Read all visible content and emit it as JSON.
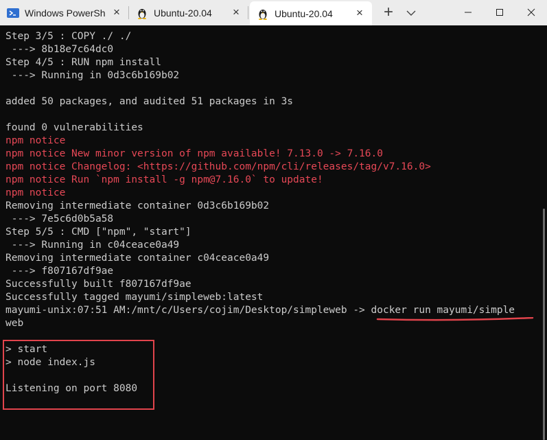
{
  "tabs": [
    {
      "label": "Windows PowerSh",
      "close": "×",
      "icon": "powershell-icon"
    },
    {
      "label": "Ubuntu-20.04",
      "close": "×",
      "icon": "linux-tux-icon"
    },
    {
      "label": "Ubuntu-20.04",
      "close": "×",
      "icon": "linux-tux-icon",
      "active": true
    }
  ],
  "toolbar": {
    "new_tab": "+",
    "dropdown_icon": "chevron-down-icon"
  },
  "window_controls": {
    "minimize_icon": "minimize-icon",
    "maximize_icon": "maximize-icon",
    "close_icon": "close-icon"
  },
  "colors": {
    "terminal_bg": "#0c0c0c",
    "text": "#cccccc",
    "error_red": "#e74856",
    "annotation_red": "#e2444c"
  },
  "terminal_lines": [
    {
      "text": "Step 3/5 : COPY ./ ./",
      "style": "normal"
    },
    {
      "text": " ---> 8b18e7c64dc0",
      "style": "normal"
    },
    {
      "text": "Step 4/5 : RUN npm install",
      "style": "normal"
    },
    {
      "text": " ---> Running in 0d3c6b169b02",
      "style": "normal"
    },
    {
      "text": "",
      "style": "normal"
    },
    {
      "text": "added 50 packages, and audited 51 packages in 3s",
      "style": "normal"
    },
    {
      "text": "",
      "style": "normal"
    },
    {
      "text": "found 0 vulnerabilities",
      "style": "normal"
    },
    {
      "text": "npm notice",
      "style": "error"
    },
    {
      "text": "npm notice New minor version of npm available! 7.13.0 -> 7.16.0",
      "style": "error"
    },
    {
      "text": "npm notice Changelog: <https://github.com/npm/cli/releases/tag/v7.16.0>",
      "style": "error"
    },
    {
      "text": "npm notice Run `npm install -g npm@7.16.0` to update!",
      "style": "error"
    },
    {
      "text": "npm notice",
      "style": "error"
    },
    {
      "text": "Removing intermediate container 0d3c6b169b02",
      "style": "normal"
    },
    {
      "text": " ---> 7e5c6d0b5a58",
      "style": "normal"
    },
    {
      "text": "Step 5/5 : CMD [\"npm\", \"start\"]",
      "style": "normal"
    },
    {
      "text": " ---> Running in c04ceace0a49",
      "style": "normal"
    },
    {
      "text": "Removing intermediate container c04ceace0a49",
      "style": "normal"
    },
    {
      "text": " ---> f807167df9ae",
      "style": "normal"
    },
    {
      "text": "Successfully built f807167df9ae",
      "style": "normal"
    },
    {
      "text": "Successfully tagged mayumi/simpleweb:latest",
      "style": "normal"
    },
    {
      "text": "mayumi-unix:07:51 AM:/mnt/c/Users/cojim/Desktop/simpleweb -> docker run mayumi/simple",
      "style": "normal"
    },
    {
      "text": "web",
      "style": "normal"
    },
    {
      "text": "",
      "style": "normal"
    },
    {
      "text": "> start",
      "style": "normal"
    },
    {
      "text": "> node index.js",
      "style": "normal"
    },
    {
      "text": "",
      "style": "normal"
    },
    {
      "text": "Listening on port 8080",
      "style": "normal"
    }
  ]
}
